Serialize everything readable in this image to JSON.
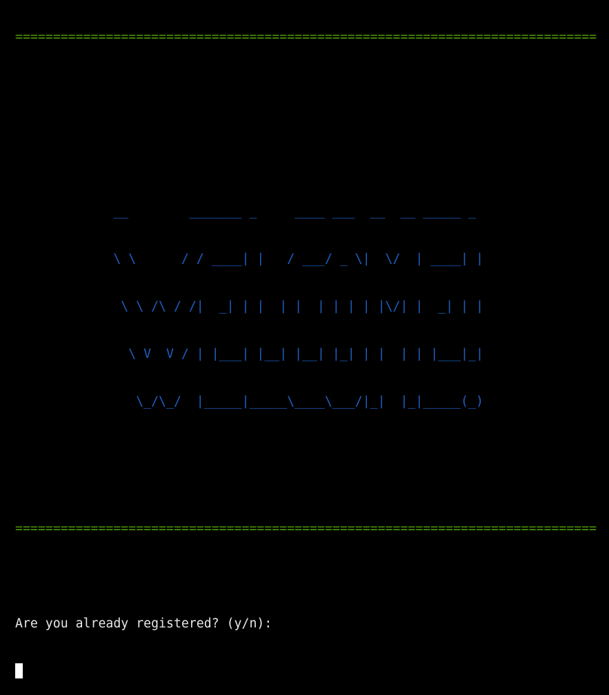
{
  "terminal": {
    "separator": "=============================================================================",
    "banner_lines": [
      "             __        _______ _     ____ ___  __  __ _____ _ ",
      "             \\ \\      / / ____| |   / ___/ _ \\|  \\/  | ____| |",
      "              \\ \\ /\\ / /|  _| | |  | |  | | | | |\\/| |  _| | |",
      "               \\ V  V / | |___| |__| |__| |_| | |  | | |___|_|",
      "                \\_/\\_/  |_____|_____\\____\\___/|_|  |_|_____(_)"
    ],
    "banner_text": "WELCOME!",
    "prompt": "Are you already registered? (y/n):",
    "colors": {
      "separator": "#4e9a06",
      "banner": "#1f5fbf",
      "text": "#e8e8e8",
      "background": "#000000"
    }
  }
}
